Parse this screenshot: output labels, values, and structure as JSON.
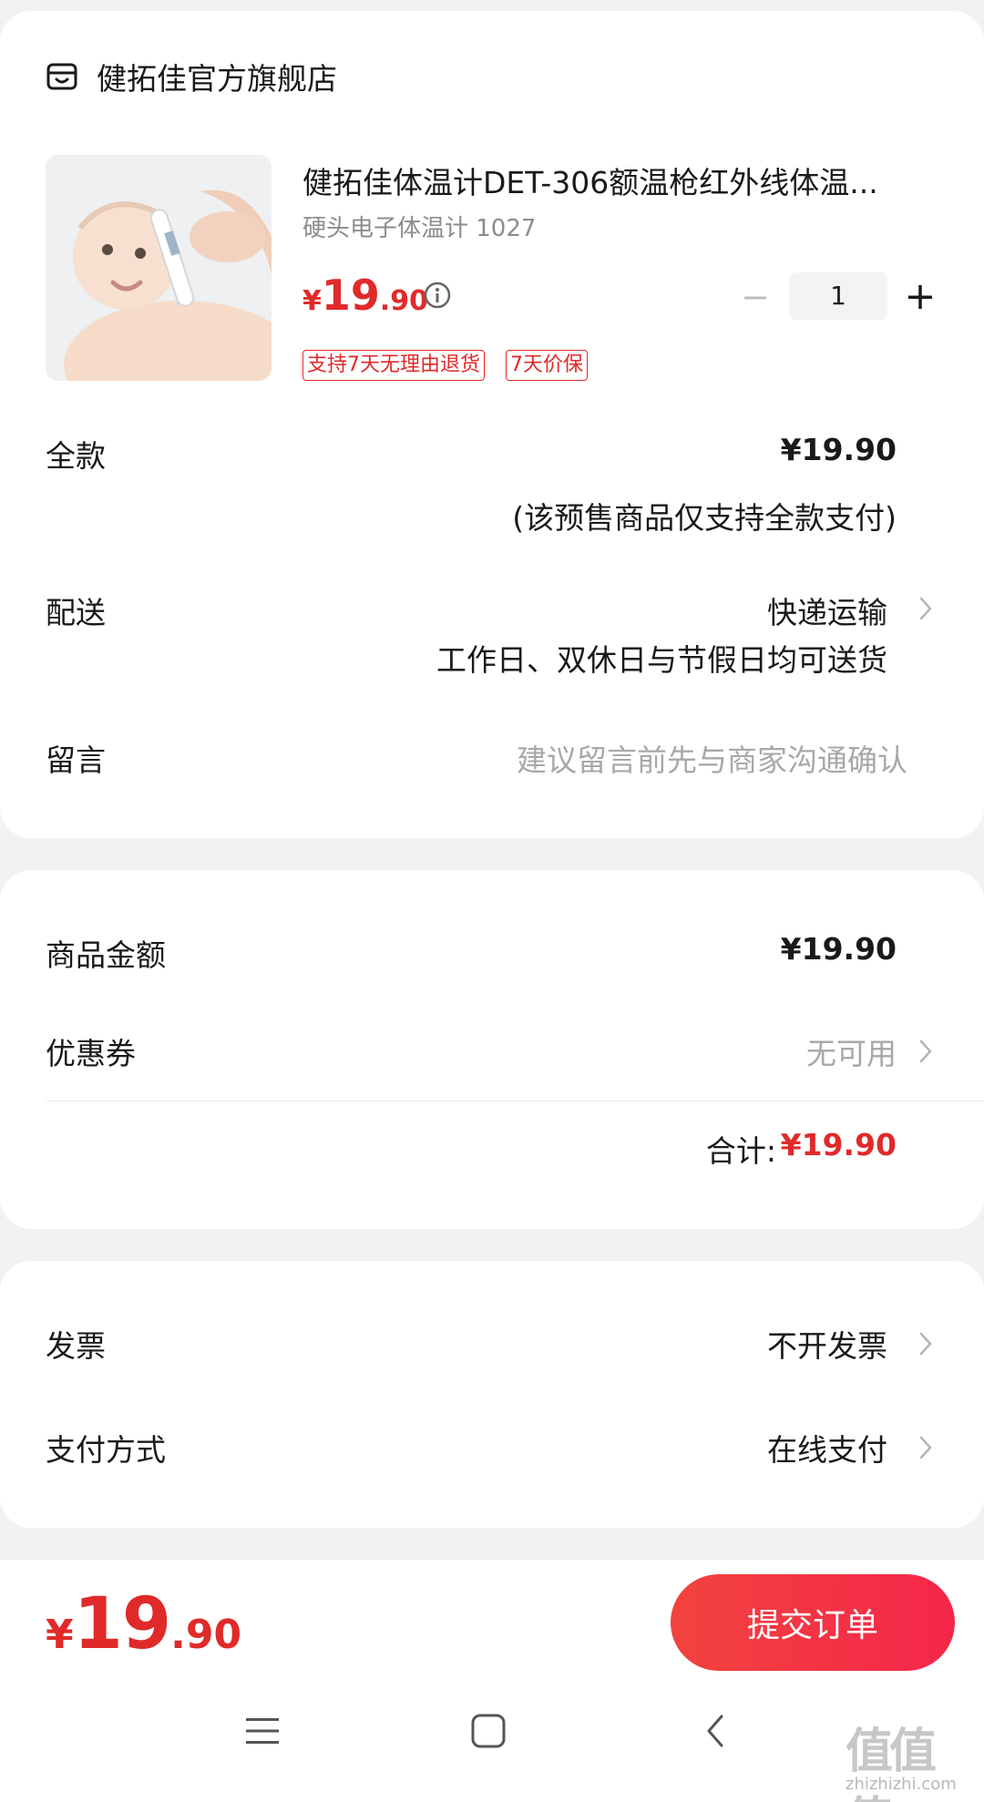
{
  "store": {
    "name": "健拓佳官方旗舰店",
    "icon": "store-icon"
  },
  "product": {
    "title": "健拓佳体温计DET-306额温枪红外线体温...",
    "spec": "硬头电子体温计 1027",
    "price": {
      "currency": "¥",
      "integer": "19",
      "decimal": ".90"
    },
    "quantity": "1",
    "tags": [
      "支持7天无理由退货",
      "7天价保"
    ]
  },
  "payment": {
    "label": "全款",
    "value": "¥19.90",
    "note": "(该预售商品仅支持全款支付)"
  },
  "delivery": {
    "label": "配送",
    "value": "快递运输",
    "note": "工作日、双休日与节假日均可送货"
  },
  "message": {
    "label": "留言",
    "placeholder": "建议留言前先与商家沟通确认"
  },
  "summary": {
    "goods_amount_label": "商品金额",
    "goods_amount_value": "¥19.90",
    "coupon_label": "优惠券",
    "coupon_value": "无可用",
    "total_label": "合计:",
    "total_value": "¥19.90"
  },
  "invoice": {
    "label": "发票",
    "value": "不开发票"
  },
  "pay_method": {
    "label": "支付方式",
    "value": "在线支付"
  },
  "bottom": {
    "price": {
      "currency": "¥",
      "integer": "19",
      "decimal": ".90"
    },
    "submit_label": "提交订单"
  },
  "watermark": {
    "logo": "值值值",
    "url": "zhizhizhi.com"
  },
  "colors": {
    "accent": "#e02a2a",
    "button": "#f5264a",
    "muted": "#a8a8a8",
    "background": "#f2f2f2"
  }
}
